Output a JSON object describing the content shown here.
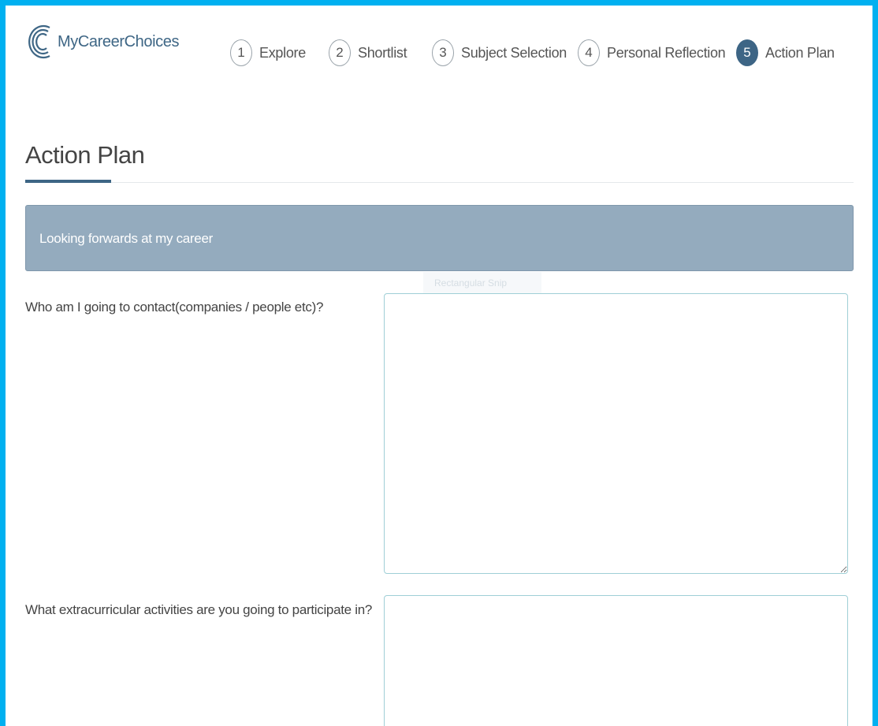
{
  "brand": {
    "name": "MyCareerChoices"
  },
  "steps": [
    {
      "num": "1",
      "label": "Explore",
      "active": false
    },
    {
      "num": "2",
      "label": "Shortlist",
      "active": false
    },
    {
      "num": "3",
      "label": "Subject Selection",
      "active": false
    },
    {
      "num": "4",
      "label": "Personal Reflection",
      "active": false
    },
    {
      "num": "5",
      "label": "Action Plan",
      "active": true
    }
  ],
  "page": {
    "title": "Action Plan"
  },
  "section": {
    "title": "Looking forwards at my career"
  },
  "overlay": {
    "snip_text": "Rectangular Snip"
  },
  "questions": [
    {
      "label": "Who am I going to contact(companies / people etc)?",
      "value": ""
    },
    {
      "label": "What extracurricular activities are you going to participate in?",
      "value": ""
    }
  ],
  "colors": {
    "accent": "#3d6585",
    "panel": "#94abbe",
    "frame": "#00b0f0",
    "input_border": "#9fcfd6"
  }
}
